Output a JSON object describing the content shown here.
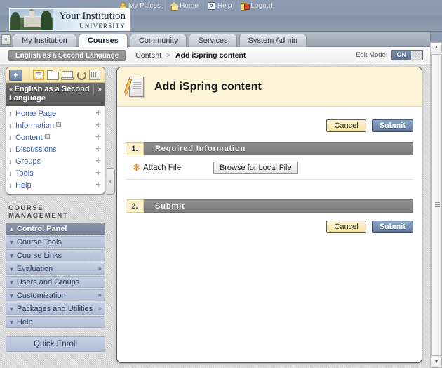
{
  "header": {
    "institution": {
      "name": "Your Institution",
      "subtitle": "UNIVERSITY"
    },
    "utility_nav": [
      {
        "label": "My Places",
        "icon": "person-icon"
      },
      {
        "label": "Home",
        "icon": "home-icon"
      },
      {
        "label": "Help",
        "icon": "question-mark-icon"
      },
      {
        "label": "Logout",
        "icon": "logout-door-icon"
      }
    ]
  },
  "tabs": [
    {
      "label": "My Institution",
      "active": false
    },
    {
      "label": "Courses",
      "active": true
    },
    {
      "label": "Community",
      "active": false
    },
    {
      "label": "Services",
      "active": false
    },
    {
      "label": "System Admin",
      "active": false
    }
  ],
  "breadcrumb": {
    "course_chip": "English as a Second Language",
    "trail": [
      "Content"
    ],
    "separator": ">",
    "current": "Add iSpring content",
    "edit_mode_label": "Edit Mode:",
    "edit_mode_value": "ON"
  },
  "course_menu": {
    "toolbar": {
      "add_label": "+",
      "icons": [
        "list-view-icon",
        "folder-view-icon",
        "display-view-icon",
        "refresh-icon",
        "keyboard-accessible-icon"
      ]
    },
    "title": "English as a Second Language",
    "collapse_caret": "«",
    "expand_caret": "»",
    "items": [
      {
        "label": "Home Page",
        "has_mini_icon": false
      },
      {
        "label": "Information",
        "has_mini_icon": true
      },
      {
        "label": "Content",
        "has_mini_icon": true
      },
      {
        "label": "Discussions",
        "has_mini_icon": false
      },
      {
        "label": "Groups",
        "has_mini_icon": false
      },
      {
        "label": "Tools",
        "has_mini_icon": false
      },
      {
        "label": "Help",
        "has_mini_icon": false
      }
    ]
  },
  "course_management": {
    "title": "COURSE MANAGEMENT",
    "items": [
      {
        "label": "Control Panel",
        "header": true,
        "more": false
      },
      {
        "label": "Course Tools",
        "header": false,
        "more": false
      },
      {
        "label": "Course Links",
        "header": false,
        "more": false
      },
      {
        "label": "Evaluation",
        "header": false,
        "more": true
      },
      {
        "label": "Users and Groups",
        "header": false,
        "more": false
      },
      {
        "label": "Customization",
        "header": false,
        "more": true
      },
      {
        "label": "Packages and Utilities",
        "header": false,
        "more": true
      },
      {
        "label": "Help",
        "header": false,
        "more": false
      }
    ],
    "quick_enroll": "Quick Enroll"
  },
  "sidebar_collapse": "‹",
  "page": {
    "title": "Add iSpring content",
    "icon": "document-with-pencil-icon",
    "buttons_top": {
      "cancel": "Cancel",
      "submit": "Submit"
    },
    "buttons_bottom": {
      "cancel": "Cancel",
      "submit": "Submit"
    },
    "sections": [
      {
        "number": "1.",
        "name": "Required Information",
        "field": {
          "required_marker": "✻",
          "label": "Attach File",
          "button": "Browse for Local File"
        }
      },
      {
        "number": "2.",
        "name": "Submit"
      }
    ]
  },
  "scrollbar": {
    "up": "▲",
    "down": "▼"
  },
  "colors": {
    "header_blue": "#8999af",
    "accent_cream": "#fdf4d8",
    "submit_blue": "#62799c",
    "required_orange": "#e8800f",
    "link_blue": "#3b5bb5",
    "section_grey": "#7c7c7c"
  }
}
